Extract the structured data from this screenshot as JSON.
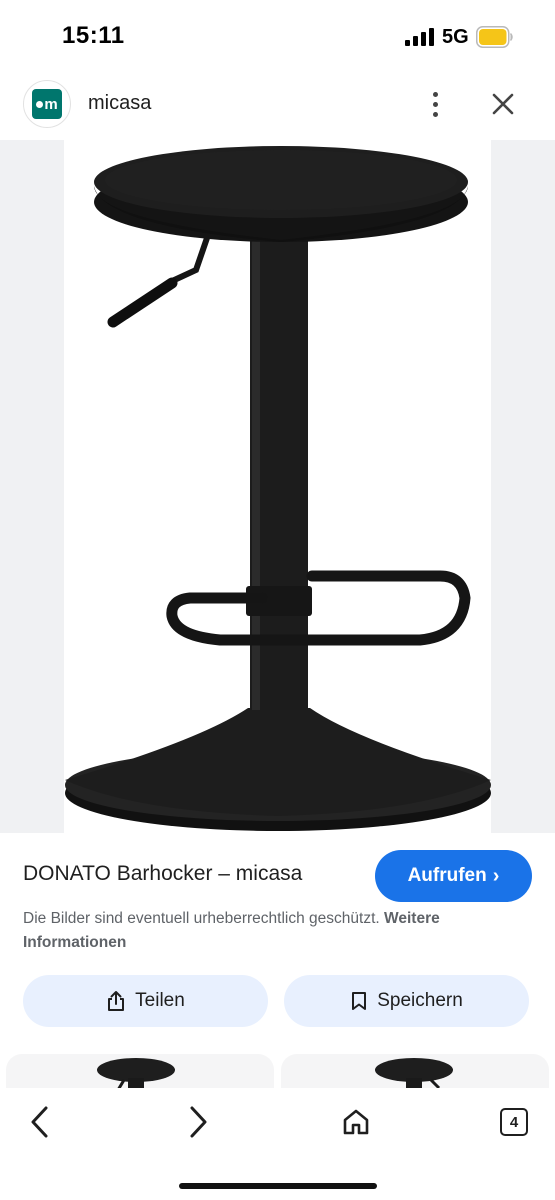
{
  "status_bar": {
    "time": "15:11",
    "network": "5G",
    "battery_color": "#f5c518"
  },
  "header": {
    "site_logo_text": "m",
    "site_name": "micasa",
    "more_icon": "more-vert-icon",
    "close_icon": "close-icon"
  },
  "product": {
    "title": "DONATO Barhocker – micasa",
    "visit_label": "Aufrufen",
    "copyright_text": "Die Bilder sind eventuell urheberrechtlich geschützt.",
    "more_info_link": "Weitere Informationen"
  },
  "actions": {
    "share_label": "Teilen",
    "save_label": "Speichern"
  },
  "bottom_nav": {
    "tab_count": "4"
  },
  "colors": {
    "accent": "#1a73e8",
    "tonal_button": "#e8f0fe",
    "brand": "#00766d"
  }
}
